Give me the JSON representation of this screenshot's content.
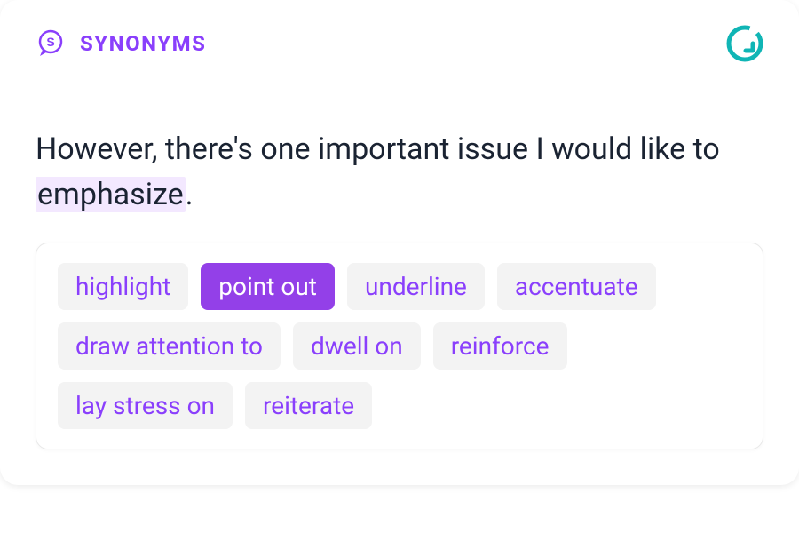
{
  "header": {
    "title": "SYNONYMS"
  },
  "sentence": {
    "before": "However, there's one important issue I would like to ",
    "highlighted": "emphasize",
    "after": "."
  },
  "synonyms": {
    "items": [
      {
        "label": "highlight",
        "selected": false
      },
      {
        "label": "point out",
        "selected": true
      },
      {
        "label": "underline",
        "selected": false
      },
      {
        "label": "accentuate",
        "selected": false
      },
      {
        "label": "draw attention to",
        "selected": false
      },
      {
        "label": "dwell on",
        "selected": false
      },
      {
        "label": "reinforce",
        "selected": false
      },
      {
        "label": "lay stress on",
        "selected": false
      },
      {
        "label": "reiterate",
        "selected": false
      }
    ]
  },
  "colors": {
    "accent": "#8a3ffc",
    "accentFill": "#9340e8",
    "logo": "#10b5b5"
  }
}
